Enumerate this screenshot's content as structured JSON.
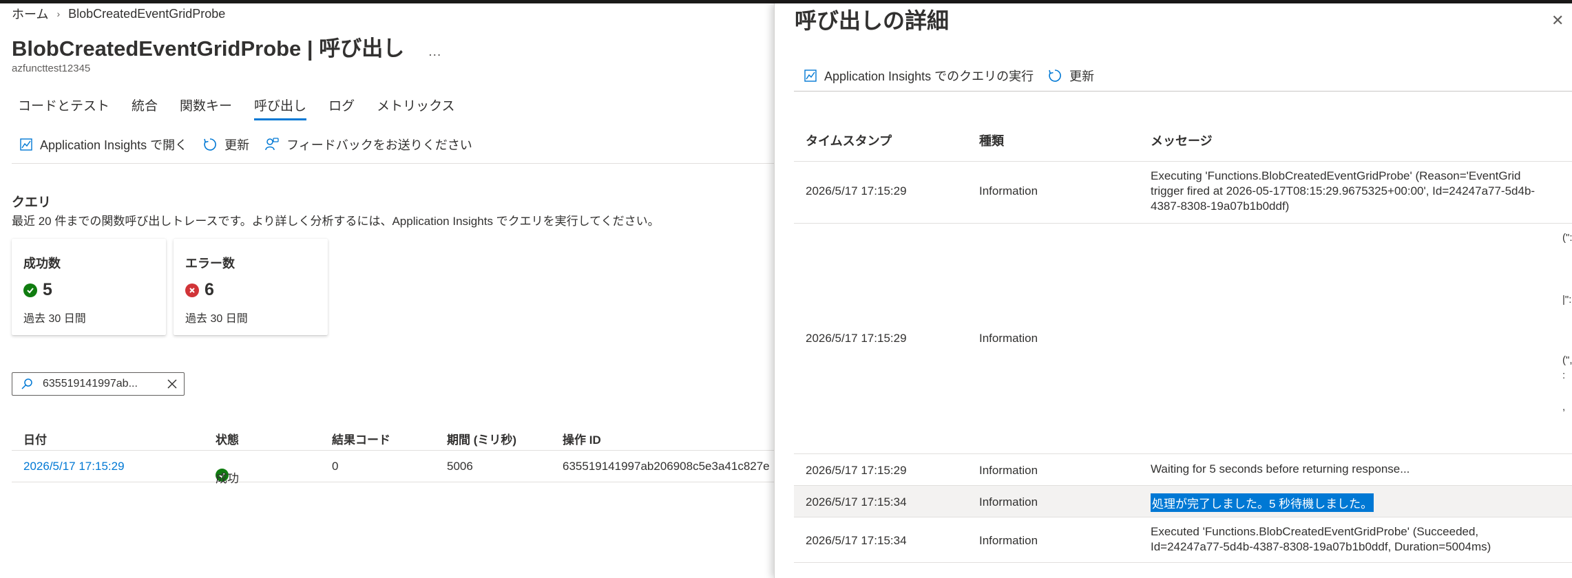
{
  "breadcrumb": {
    "home": "ホーム",
    "current": "BlobCreatedEventGridProbe"
  },
  "header": {
    "title": "BlobCreatedEventGridProbe | 呼び出し",
    "more": "…",
    "subtitle": "azfuncttest12345"
  },
  "tabs": [
    {
      "label": "コードとテスト"
    },
    {
      "label": "統合"
    },
    {
      "label": "関数キー"
    },
    {
      "label": "呼び出し",
      "active": true
    },
    {
      "label": "ログ"
    },
    {
      "label": "メトリックス"
    }
  ],
  "toolbar": {
    "open_ai": "Application Insights で開く",
    "refresh": "更新",
    "feedback": "フィードバックをお送りください"
  },
  "query": {
    "title": "クエリ",
    "description": "最近 20 件までの関数呼び出しトレースです。より詳しく分析するには、Application Insights でクエリを実行してください。"
  },
  "cards": {
    "success": {
      "title": "成功数",
      "value": "5",
      "footer": "過去 30 日間",
      "color": "#107c10"
    },
    "error": {
      "title": "エラー数",
      "value": "6",
      "footer": "過去 30 日間",
      "color": "#d13438"
    }
  },
  "search": {
    "value": "635519141997ab..."
  },
  "invocations": {
    "headers": {
      "date": "日付",
      "status": "状態",
      "code": "結果コード",
      "duration": "期間 (ミリ秒)",
      "op": "操作 ID"
    },
    "rows": [
      {
        "date": "2026/5/17 17:15:29",
        "status": "成功",
        "code": "0",
        "duration": "5006",
        "op": "635519141997ab206908c5e3a41c827e"
      }
    ]
  },
  "panel": {
    "title": "呼び出しの詳細",
    "close": "✕",
    "run_query": "Application Insights でのクエリの実行",
    "refresh": "更新",
    "headers": {
      "timestamp": "タイムスタンプ",
      "type": "種類",
      "message": "メッセージ"
    },
    "rows": [
      {
        "timestamp": "2026/5/17 17:15:29",
        "type": "Information",
        "message_lines": [
          "Executing 'Functions.BlobCreatedEventGridProbe' (Reason='EventGrid",
          "trigger fired at 2026-05-17T08:15:29.9675325+00:00', Id=24247a77-5d4b-",
          "4387-8308-19a07b1b0ddf)"
        ]
      },
      {
        "timestamp": "2026/5/17 17:15:29",
        "type": "Information",
        "fragments": [
          "(\":",
          "|\":",
          "(\",",
          ":",
          ","
        ]
      },
      {
        "timestamp": "2026/5/17 17:15:29",
        "type": "Information",
        "message": "Waiting for 5 seconds before returning response..."
      },
      {
        "timestamp": "2026/5/17 17:15:34",
        "type": "Information",
        "message": "処理が完了しました。5 秒待機しました。",
        "highlighted": true
      },
      {
        "timestamp": "2026/5/17 17:15:34",
        "type": "Information",
        "message_lines": [
          "Executed 'Functions.BlobCreatedEventGridProbe' (Succeeded,",
          "Id=24247a77-5d4b-4387-8308-19a07b1b0ddf, Duration=5004ms)"
        ]
      }
    ]
  },
  "colors": {
    "accent": "#0078d4",
    "success": "#107c10",
    "error": "#d13438"
  }
}
